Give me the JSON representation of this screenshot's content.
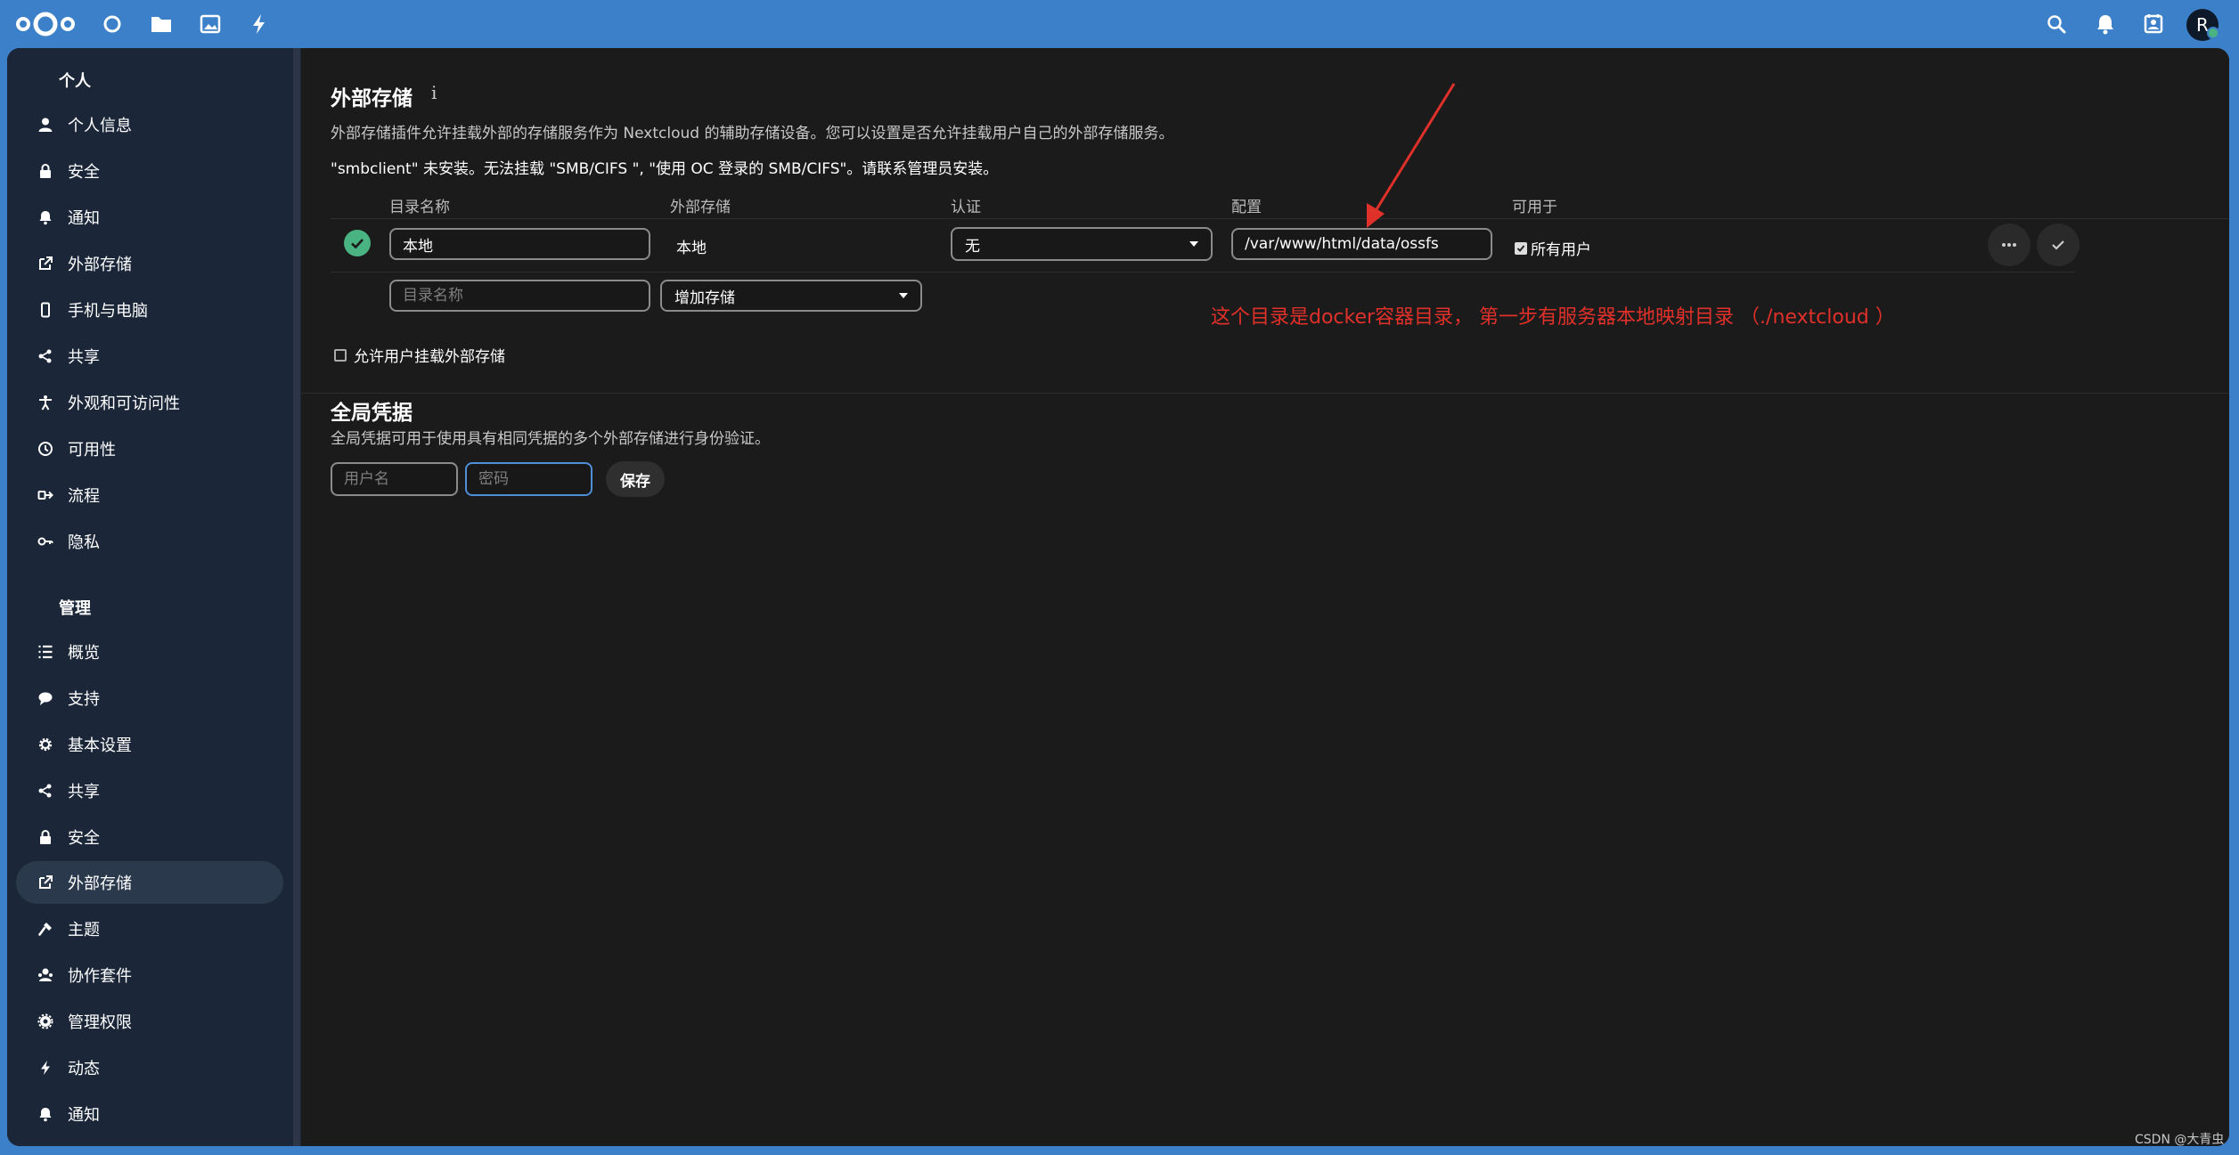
{
  "sidebar": {
    "personal_heading": "个人",
    "personal_items": [
      {
        "label": "个人信息",
        "icon": "user-icon"
      },
      {
        "label": "安全",
        "icon": "lock-icon"
      },
      {
        "label": "通知",
        "icon": "bell-icon"
      },
      {
        "label": "外部存储",
        "icon": "external-link-icon"
      },
      {
        "label": "手机与电脑",
        "icon": "phone-icon"
      },
      {
        "label": "共享",
        "icon": "share-icon"
      },
      {
        "label": "外观和可访问性",
        "icon": "accessibility-icon"
      },
      {
        "label": "可用性",
        "icon": "clock-icon"
      },
      {
        "label": "流程",
        "icon": "flow-icon"
      },
      {
        "label": "隐私",
        "icon": "key-icon"
      }
    ],
    "admin_heading": "管理",
    "admin_items": [
      {
        "label": "概览",
        "icon": "list-icon"
      },
      {
        "label": "支持",
        "icon": "chat-icon"
      },
      {
        "label": "基本设置",
        "icon": "gear-icon"
      },
      {
        "label": "共享",
        "icon": "share-icon"
      },
      {
        "label": "安全",
        "icon": "lock-icon"
      },
      {
        "label": "外部存储",
        "icon": "external-link-icon",
        "active": true
      },
      {
        "label": "主题",
        "icon": "brush-icon"
      },
      {
        "label": "协作套件",
        "icon": "office-icon"
      },
      {
        "label": "管理权限",
        "icon": "admin-gear-icon"
      },
      {
        "label": "动态",
        "icon": "lightning-icon"
      },
      {
        "label": "通知",
        "icon": "bell-icon"
      }
    ]
  },
  "external_storage": {
    "title": "外部存储",
    "info_icon": "i",
    "description": "外部存储插件允许挂载外部的存储服务作为 Nextcloud 的辅助存储设备。您可以设置是否允许挂载用户自己的外部存储服务。",
    "warning": "\"smbclient\" 未安装。无法挂载 \"SMB/CIFS \", \"使用 OC 登录的 SMB/CIFS\"。请联系管理员安装。",
    "columns": [
      "目录名称",
      "外部存储",
      "认证",
      "配置",
      "可用于"
    ],
    "row": {
      "folder_name": "本地",
      "backend": "本地",
      "auth": "无",
      "config": "/var/www/html/data/ossfs",
      "available_for": "所有用户"
    },
    "new_row": {
      "folder_placeholder": "目录名称",
      "add_storage": "增加存储"
    },
    "allow_user_mount": "允许用户挂载外部存储"
  },
  "annotation": "这个目录是docker容器目录， 第一步有服务器本地映射目录 （./nextcloud ）",
  "global_credentials": {
    "title": "全局凭据",
    "description": "全局凭据可用于使用具有相同凭据的多个外部存储进行身份验证。",
    "username_placeholder": "用户名",
    "password_placeholder": "密码",
    "save_label": "保存"
  },
  "header": {
    "avatar_initial": "R"
  },
  "watermark": "CSDN @大青虫",
  "colors": {
    "header_bg": "#3b80c8",
    "sidebar_bg": "#1b2739",
    "main_bg": "#1b1b1b",
    "success": "#49b382",
    "annotation": "#e0302a"
  }
}
